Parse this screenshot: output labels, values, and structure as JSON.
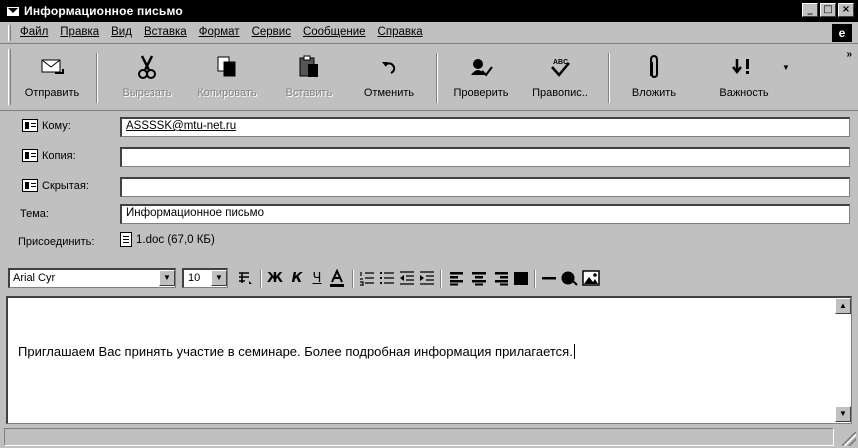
{
  "window": {
    "title": "Информационное письмо",
    "buttons": [
      "_",
      "□",
      "×"
    ]
  },
  "menu": {
    "items": [
      "Файл",
      "Правка",
      "Вид",
      "Вставка",
      "Формат",
      "Сервис",
      "Сообщение",
      "Справка"
    ]
  },
  "toolbar": {
    "send": "Отправить",
    "cut": "Вырезать",
    "copy": "Копировать",
    "paste": "Вставить",
    "undo": "Отменить",
    "check": "Проверить",
    "spelling": "Правопис..",
    "attach": "Вложить",
    "priority": "Важность",
    "more": "»"
  },
  "fields": {
    "to_label": "Кому:",
    "to_value": "ASSSSK@mtu-net.ru",
    "cc_label": "Копия:",
    "cc_value": "",
    "bcc_label": "Скрытая:",
    "bcc_value": "",
    "subject_label": "Тема:",
    "subject_value": "Информационное письмо",
    "attach_label": "Присоединить:",
    "attach_value": "1.doc (67,0 КБ)"
  },
  "format": {
    "font": "Arial Cyr",
    "size": "10"
  },
  "message": {
    "body": "Приглашаем Вас принять участие в семинаре. Более подробная информация прилагается."
  }
}
